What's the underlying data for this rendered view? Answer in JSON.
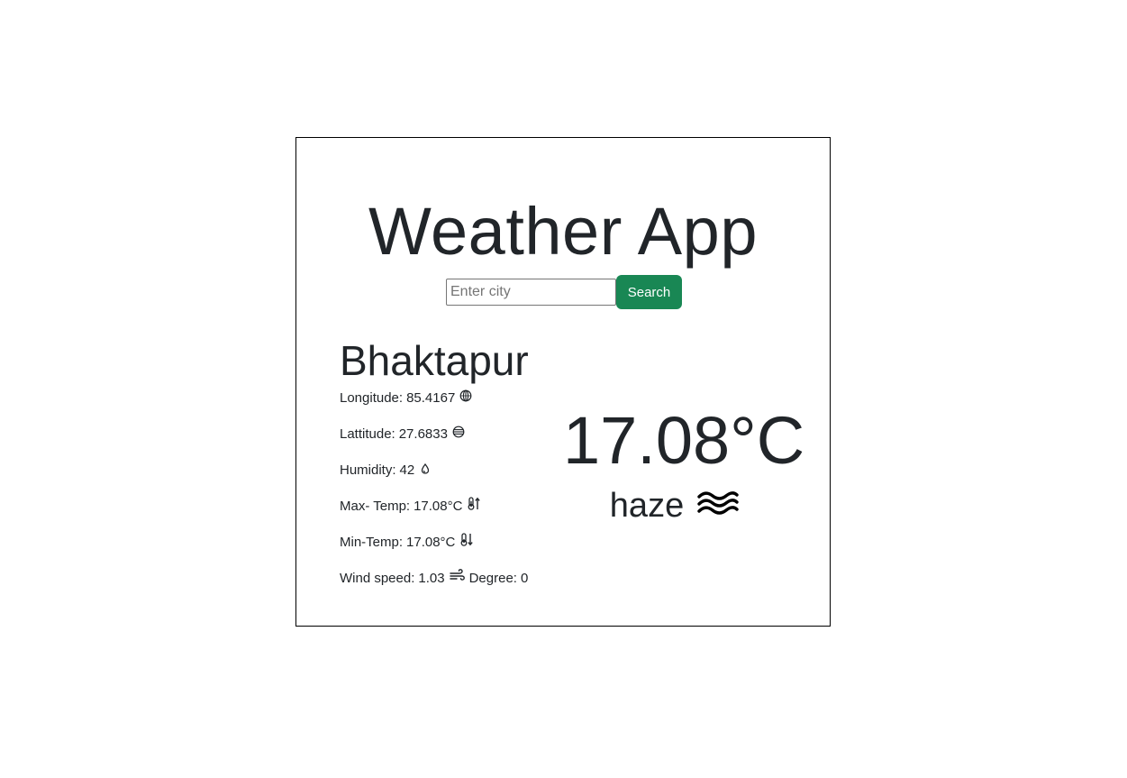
{
  "app": {
    "title": "Weather App"
  },
  "search": {
    "placeholder": "Enter city",
    "value": "",
    "button_label": "Search"
  },
  "weather": {
    "city": "Bhaktapur",
    "longitude_label": "Longitude:",
    "longitude": "85.4167",
    "latitude_label": "Lattitude:",
    "latitude": "27.6833",
    "humidity_label": "Humidity:",
    "humidity": "42",
    "max_temp_label": "Max- Temp:",
    "max_temp": "17.08°C",
    "min_temp_label": "Min-Temp:",
    "min_temp": "17.08°C",
    "wind_label": "Wind speed:",
    "wind_speed": "1.03",
    "degree_label": "Degree:",
    "degree": "0",
    "temperature": "17.08°C",
    "condition": "haze"
  },
  "icons": {
    "longitude": "globe-icon",
    "latitude": "globe-lines-icon",
    "humidity": "droplet-icon",
    "max_temp": "thermometer-up-icon",
    "min_temp": "thermometer-down-icon",
    "wind": "wind-icon",
    "condition": "haze-waves-icon"
  },
  "colors": {
    "primary_button": "#198754",
    "text": "#212529",
    "border": "#000000"
  }
}
